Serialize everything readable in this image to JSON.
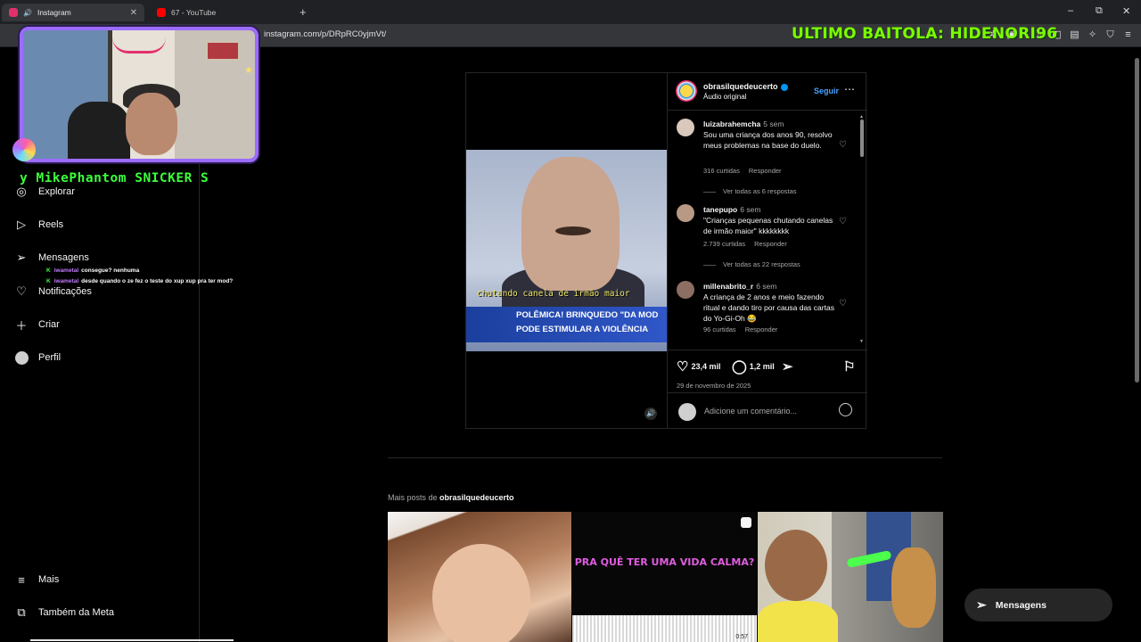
{
  "browser": {
    "tabs": [
      {
        "label": "Instagram",
        "favicon_color": "#e1306c",
        "active": true
      },
      {
        "label": "67 - YouTube",
        "favicon_color": "#ff0000",
        "active": false
      }
    ],
    "url": "instagram.com/p/DRpRC0yjmVt/",
    "window_controls": {
      "minimize": "–",
      "restore": "⧉",
      "close": "✕"
    }
  },
  "stream_overlay": {
    "title": "ULTIMO BAITOLA: HIDENORI96",
    "ticker": "y  MikePhantom  SNICKER  S",
    "chat": [
      {
        "badge": "K",
        "user": "iwametal",
        "message": "consegue? nenhuma"
      },
      {
        "badge": "K",
        "user": "iwametal",
        "message": "desde quando o ze fez o teste do xup xup pra ter mod?"
      }
    ]
  },
  "sidebar": {
    "items": [
      {
        "label": "Explorar",
        "icon": "compass-icon"
      },
      {
        "label": "Reels",
        "icon": "reels-icon"
      },
      {
        "label": "Mensagens",
        "icon": "send-icon"
      },
      {
        "label": "Notificações",
        "icon": "heart-icon"
      },
      {
        "label": "Criar",
        "icon": "plus-icon"
      },
      {
        "label": "Perfil",
        "icon": "profile-icon"
      }
    ],
    "bottom": [
      {
        "label": "Mais",
        "icon": "menu-icon"
      },
      {
        "label": "Também da Meta",
        "icon": "meta-icon"
      }
    ]
  },
  "post": {
    "username": "obrasilquedeucerto",
    "audio": "Áudio original",
    "follow_label": "Seguir",
    "video": {
      "subtitle": "chutando canela de irmão maior",
      "banner_line1": "POLÊMICA! BRINQUEDO \"DA MOD",
      "banner_line2": "PODE ESTIMULAR A VIOLÊNCIA"
    },
    "comments": [
      {
        "user": "luizabrahemcha",
        "time": "5 sem",
        "text": "Sou uma criança dos anos 90, resolvo meus problemas na base do duelo.",
        "likes": "316 curtidas",
        "reply": "Responder",
        "replies": "Ver todas as 6 respostas",
        "avatar_color": "#d9c9bd"
      },
      {
        "user": "tanepupo",
        "time": "6 sem",
        "text": "\"Crianças pequenas chutando canelas de irmão maior\" kkkkkkkk",
        "likes": "2.739 curtidas",
        "reply": "Responder",
        "replies": "Ver todas as 22 respostas",
        "avatar_color": "#b89a84"
      },
      {
        "user": "millenabrito_r",
        "time": "6 sem",
        "text": "A criança de 2 anos e meio fazendo ritual e dando tiro por causa das cartas do Yo-Gi-Oh 😂",
        "likes": "96 curtidas",
        "reply": "Responder",
        "avatar_color": "#8d6e63"
      }
    ],
    "likes": "23,4 mil",
    "comments_count": "1,2 mil",
    "date": "29 de novembro de 2025",
    "add_comment_placeholder": "Adicione um comentário..."
  },
  "more_posts": {
    "prefix": "Mais posts de ",
    "username": "obrasilquedeucerto",
    "items": [
      {
        "type": "photo"
      },
      {
        "type": "reel",
        "text": "PRA QUÊ TER UMA VIDA CALMA?",
        "duration": "0:57"
      },
      {
        "type": "photo"
      }
    ]
  },
  "messages_button": {
    "label": "Mensagens"
  }
}
